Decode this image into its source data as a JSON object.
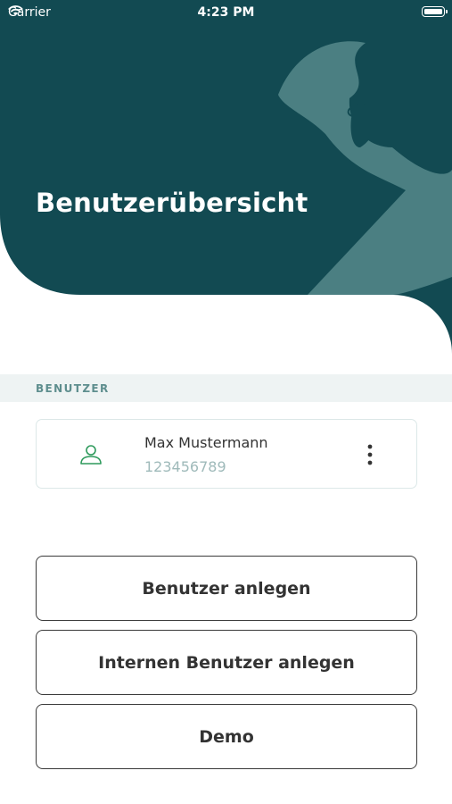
{
  "status_bar": {
    "carrier": "Carrier",
    "time": "4:23 PM"
  },
  "header": {
    "title": "Benutzerübersicht",
    "background_color": "#124a52",
    "decoration_color": "#4b7f82"
  },
  "section": {
    "label": "BENUTZER"
  },
  "users": [
    {
      "name": "Max Mustermann",
      "number": "123456789",
      "icon": "person-icon",
      "menu_icon": "more-vertical-icon"
    }
  ],
  "actions": {
    "create_user": "Benutzer anlegen",
    "create_internal_user": "Internen Benutzer anlegen",
    "demo": "Demo"
  }
}
